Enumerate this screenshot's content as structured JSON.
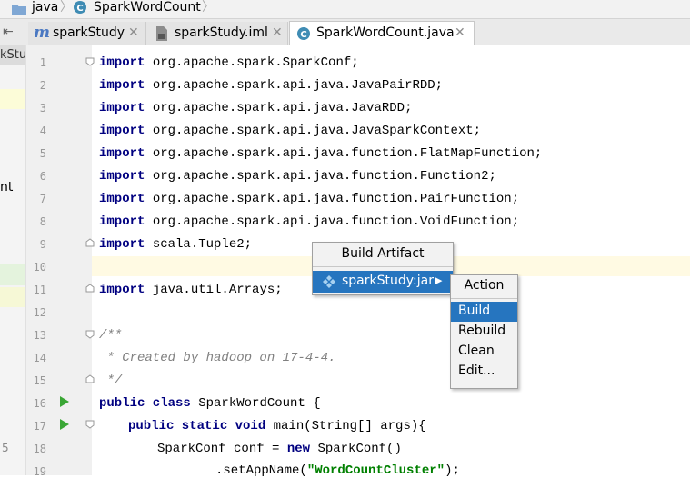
{
  "breadcrumb": {
    "items": [
      "java",
      "SparkWordCount"
    ]
  },
  "tabs": [
    {
      "label": "sparkStudy",
      "icon": "maven-icon"
    },
    {
      "label": "sparkStudy.iml",
      "icon": "iml-file-icon"
    },
    {
      "label": "SparkWordCount.java",
      "icon": "java-class-icon"
    }
  ],
  "left_panel": {
    "text1": "kStu",
    "text2": "nt",
    "num": "5"
  },
  "line_numbers": [
    "1",
    "2",
    "3",
    "4",
    "5",
    "6",
    "7",
    "8",
    "9",
    "10",
    "11",
    "12",
    "13",
    "14",
    "15",
    "16",
    "17",
    "18",
    "19"
  ],
  "code": {
    "l1_kw": "import",
    "l1": " org.apache.spark.SparkConf;",
    "l2_kw": "import",
    "l2": " org.apache.spark.api.java.JavaPairRDD;",
    "l3_kw": "import",
    "l3": " org.apache.spark.api.java.JavaRDD;",
    "l4_kw": "import",
    "l4": " org.apache.spark.api.java.JavaSparkContext;",
    "l5_kw": "import",
    "l5": " org.apache.spark.api.java.function.FlatMapFunction;",
    "l6_kw": "import",
    "l6": " org.apache.spark.api.java.function.Function2;",
    "l7_kw": "import",
    "l7": " org.apache.spark.api.java.function.PairFunction;",
    "l8_kw": "import",
    "l8": " org.apache.spark.api.java.function.VoidFunction;",
    "l9_kw": "import",
    "l9": " scala.Tuple2;",
    "l11_kw": "import",
    "l11": " java.util.Arrays;",
    "l13": "/**",
    "l14": " * Created by hadoop on 17-4-4.",
    "l15": " */",
    "l16_kw": "public class",
    "l16": " SparkWordCount {",
    "l17_kw": "public static void",
    "l17": " main(String[] args){",
    "l18_a": "SparkConf conf = ",
    "l18_kw": "new",
    "l18_b": " SparkConf()",
    "l19_a": ".setAppName(",
    "l19_str": "\"WordCountCluster\"",
    "l19_b": ");"
  },
  "build_menu": {
    "title": "Build Artifact",
    "item": "sparkStudy:jar",
    "item_icon": "artifact-icon"
  },
  "action_menu": {
    "title": "Action",
    "items": [
      "Build",
      "Rebuild",
      "Clean",
      "Edit..."
    ]
  },
  "colors": {
    "selection": "#2675bf",
    "keyword": "#000080",
    "comment": "#808080",
    "string": "#008000",
    "run": "#3aa635"
  }
}
